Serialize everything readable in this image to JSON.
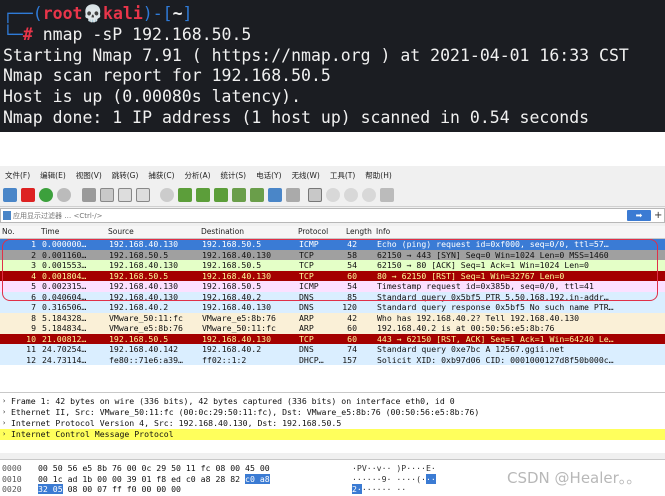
{
  "terminal": {
    "prompt_open": "┌──(",
    "prompt_user": "root",
    "prompt_skull": "💀",
    "prompt_host": "kali",
    "prompt_mid": ")-[",
    "prompt_dir": "~",
    "prompt_close": "]",
    "prompt_line2": "└─",
    "prompt_hash": "#",
    "command": " nmap -sP 192.168.50.5",
    "output": [
      "Starting Nmap 7.91 ( https://nmap.org ) at 2021-04-01 16:33 CST",
      "Nmap scan report for 192.168.50.5",
      "Host is up (0.00080s latency).",
      "Nmap done: 1 IP address (1 host up) scanned in 0.54 seconds"
    ]
  },
  "wireshark": {
    "menu": [
      "文件(F)",
      "编辑(E)",
      "视图(V)",
      "跳转(G)",
      "捕获(C)",
      "分析(A)",
      "统计(S)",
      "电话(Y)",
      "无线(W)",
      "工具(T)",
      "帮助(H)"
    ],
    "filter": {
      "placeholder": "应用显示过滤器 … <Ctrl-/>",
      "apply_label": "➡",
      "add_label": "+"
    },
    "columns": [
      "No.",
      "Time",
      "Source",
      "Destination",
      "Protocol",
      "Length",
      "Info"
    ],
    "packets": [
      {
        "no": "1",
        "time": "0.000000…",
        "src": "192.168.40.130",
        "dst": "192.168.50.5",
        "proto": "ICMP",
        "len": "42",
        "info": "Echo (ping) request  id=0xf000, seq=0/0, ttl=57…",
        "bg": "#3a7bd5",
        "fg": "#ffffff"
      },
      {
        "no": "2",
        "time": "0.001160…",
        "src": "192.168.50.5",
        "dst": "192.168.40.130",
        "proto": "TCP",
        "len": "58",
        "info": "62150 → 443 [SYN] Seq=0 Win=1024 Len=0 MSS=1460",
        "bg": "#a0a0a0",
        "fg": "#111111"
      },
      {
        "no": "3",
        "time": "0.001553…",
        "src": "192.168.40.130",
        "dst": "192.168.50.5",
        "proto": "TCP",
        "len": "54",
        "info": "62150 → 80 [ACK] Seq=1 Ack=1 Win=1024 Len=0",
        "bg": "#e4ffc7",
        "fg": "#111111"
      },
      {
        "no": "4",
        "time": "0.001804…",
        "src": "192.168.50.5",
        "dst": "192.168.40.130",
        "proto": "TCP",
        "len": "60",
        "info": "80 → 62150 [RST] Seq=1 Win=32767 Len=0",
        "bg": "#a40000",
        "fg": "#fffc9c"
      },
      {
        "no": "5",
        "time": "0.002315…",
        "src": "192.168.40.130",
        "dst": "192.168.50.5",
        "proto": "ICMP",
        "len": "54",
        "info": "Timestamp request    id=0x385b, seq=0/0, ttl=41",
        "bg": "#fce0ff",
        "fg": "#111111"
      },
      {
        "no": "6",
        "time": "0.040604…",
        "src": "192.168.40.130",
        "dst": "192.168.40.2",
        "proto": "DNS",
        "len": "85",
        "info": "Standard query 0x5bf5 PTR 5.50.168.192.in-addr…",
        "bg": "#daeeff",
        "fg": "#111111"
      },
      {
        "no": "7",
        "time": "0.316506…",
        "src": "192.168.40.2",
        "dst": "192.168.40.130",
        "proto": "DNS",
        "len": "120",
        "info": "Standard query response 0x5bf5 No such name PTR…",
        "bg": "#daeeff",
        "fg": "#111111"
      },
      {
        "no": "8",
        "time": "5.184328…",
        "src": "VMware_50:11:fc",
        "dst": "VMware_e5:8b:76",
        "proto": "ARP",
        "len": "42",
        "info": "Who has 192.168.40.2? Tell 192.168.40.130",
        "bg": "#faf0d7",
        "fg": "#111111"
      },
      {
        "no": "9",
        "time": "5.184834…",
        "src": "VMware_e5:8b:76",
        "dst": "VMware_50:11:fc",
        "proto": "ARP",
        "len": "60",
        "info": "192.168.40.2 is at 00:50:56:e5:8b:76",
        "bg": "#faf0d7",
        "fg": "#111111"
      },
      {
        "no": "10",
        "time": "21.00812…",
        "src": "192.168.50.5",
        "dst": "192.168.40.130",
        "proto": "TCP",
        "len": "60",
        "info": "443 → 62150 [RST, ACK] Seq=1 Ack=1 Win=64240 Le…",
        "bg": "#a40000",
        "fg": "#fffc9c"
      },
      {
        "no": "11",
        "time": "24.70254…",
        "src": "192.168.40.142",
        "dst": "192.168.40.2",
        "proto": "DNS",
        "len": "74",
        "info": "Standard query 0xe7bc A 12567.ggii.net",
        "bg": "#daeeff",
        "fg": "#111111"
      },
      {
        "no": "12",
        "time": "24.73114…",
        "src": "fe80::71e6:a39…",
        "dst": "ff02::1:2",
        "proto": "DHCP…",
        "len": "157",
        "info": "Solicit XID: 0xb97d06 CID: 0001000127d8f50b000c…",
        "bg": "#daeeff",
        "fg": "#111111"
      }
    ],
    "details": [
      {
        "text": "Frame 1: 42 bytes on wire (336 bits), 42 bytes captured (336 bits) on interface eth0, id 0",
        "selected": false
      },
      {
        "text": "Ethernet II, Src: VMware_50:11:fc (00:0c:29:50:11:fc), Dst: VMware_e5:8b:76 (00:50:56:e5:8b:76)",
        "selected": false
      },
      {
        "text": "Internet Protocol Version 4, Src: 192.168.40.130, Dst: 192.168.50.5",
        "selected": false
      },
      {
        "text": "Internet Control Message Protocol",
        "selected": true
      }
    ],
    "bytes": [
      {
        "offset": "0000",
        "hex_a": "00 50 56 e5 8b 76 00 0c  29 50 11 fc 08 00 45 00",
        "hex_hl": "",
        "hex_b": "",
        "ascii_a": "·PV··v·· )P····E·",
        "ascii_hl": "",
        "ascii_b": ""
      },
      {
        "offset": "0010",
        "hex_a": "00 1c ad 1b 00 00 39 01  f8 ed c0 a8 28 82 ",
        "hex_hl": "c0 a8",
        "hex_b": "",
        "ascii_a": "······9· ····(·",
        "ascii_hl": "··",
        "ascii_b": ""
      },
      {
        "offset": "0020",
        "hex_a": "",
        "hex_hl": "32 05",
        "hex_b": " 08 00 07 ff f0 00  00 00",
        "ascii_a": "",
        "ascii_hl": "2·",
        "ascii_b": "······ ··"
      }
    ]
  },
  "watermark": "CSDN @Healer。。",
  "colors": {
    "terminal_bg": "#1b1d22",
    "accent_red": "#e8354a",
    "selection_blue": "#3a7bd5",
    "icmp_yellow": "#ffff5c"
  }
}
